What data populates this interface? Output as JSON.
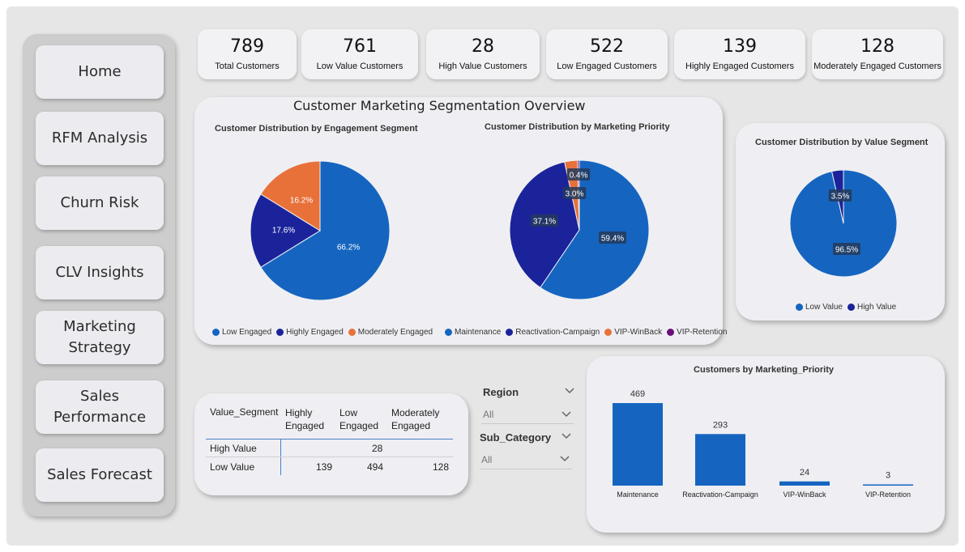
{
  "nav": [
    {
      "label": "Home",
      "name": "nav-home"
    },
    {
      "label": "RFM Analysis",
      "name": "nav-rfm-analysis"
    },
    {
      "label": "Churn Risk",
      "name": "nav-churn-risk"
    },
    {
      "label": "CLV Insights",
      "name": "nav-clv-insights"
    },
    {
      "label": "Marketing Strategy",
      "line1": "Marketing",
      "line2": "Strategy",
      "name": "nav-marketing-strategy"
    },
    {
      "label": "Sales Performance",
      "line1": "Sales",
      "line2": "Performance",
      "name": "nav-sales-performance"
    },
    {
      "label": "Sales Forecast",
      "name": "nav-sales-forecast"
    }
  ],
  "kpis": [
    {
      "value": "789",
      "label": "Total Customers"
    },
    {
      "value": "761",
      "label": "Low Value Customers"
    },
    {
      "value": "28",
      "label": "High Value Customers"
    },
    {
      "value": "522",
      "label": "Low Engaged Customers"
    },
    {
      "value": "139",
      "label": "Highly Engaged Customers"
    },
    {
      "value": "128",
      "label": "Moderately Engaged Customers"
    }
  ],
  "overview": {
    "title": "Customer Marketing Segmentation Overview"
  },
  "colors": {
    "blue": "#1565c0",
    "navy": "#1a239a",
    "orange": "#e8713a",
    "purple": "#6a0f7a"
  },
  "chart_data": [
    {
      "type": "pie",
      "title": "Customer Distribution by Engagement Segment",
      "categories": [
        "Low Engaged",
        "Highly Engaged",
        "Moderately Engaged"
      ],
      "values": [
        66.2,
        17.6,
        16.2
      ],
      "labels": [
        "66.2%",
        "17.6%",
        "16.2%"
      ],
      "colors": [
        "#1565c0",
        "#1a239a",
        "#e8713a"
      ],
      "legend": "bottom"
    },
    {
      "type": "pie",
      "title": "Customer Distribution by Marketing Priority",
      "categories": [
        "Maintenance",
        "Reactivation-Campaign",
        "VIP-WinBack",
        "VIP-Retention"
      ],
      "values": [
        59.4,
        37.1,
        3.0,
        0.4
      ],
      "labels": [
        "59.4%",
        "37.1%",
        "3.0%",
        "0.4%"
      ],
      "colors": [
        "#1565c0",
        "#1a239a",
        "#e8713a",
        "#6a0f7a"
      ],
      "legend": "bottom"
    },
    {
      "type": "pie",
      "title": "Customer Distribution by Value Segment",
      "categories": [
        "Low Value",
        "High Value"
      ],
      "values": [
        96.5,
        3.5
      ],
      "labels": [
        "96.5%",
        "3.5%"
      ],
      "colors": [
        "#1565c0",
        "#1a239a"
      ],
      "legend": "bottom"
    },
    {
      "type": "bar",
      "title": "Customers by Marketing_Priority",
      "categories": [
        "Maintenance",
        "Reactivation-Campaign",
        "VIP-WinBack",
        "VIP-Retention"
      ],
      "values": [
        469,
        293,
        24,
        3
      ],
      "labels": [
        "469",
        "293",
        "24",
        "3"
      ],
      "color": "#1565c0",
      "ylim": [
        0,
        469
      ],
      "grid": false
    }
  ],
  "matrix": {
    "header": [
      "Value_Segment",
      "Highly Engaged",
      "Low Engaged",
      "Moderately Engaged"
    ],
    "header_lines": [
      [
        "Value_Segment"
      ],
      [
        "Highly",
        "Engaged"
      ],
      [
        "Low",
        "Engaged"
      ],
      [
        "Moderately",
        "Engaged"
      ]
    ],
    "rows": [
      {
        "label": "High Value",
        "highly": "",
        "low": "28",
        "moderately": ""
      },
      {
        "label": "Low Value",
        "highly": "139",
        "low": "494",
        "moderately": "128"
      }
    ]
  },
  "slicers": [
    {
      "title": "Region",
      "value": "All"
    },
    {
      "title": "Sub_Category",
      "value": "All"
    }
  ]
}
